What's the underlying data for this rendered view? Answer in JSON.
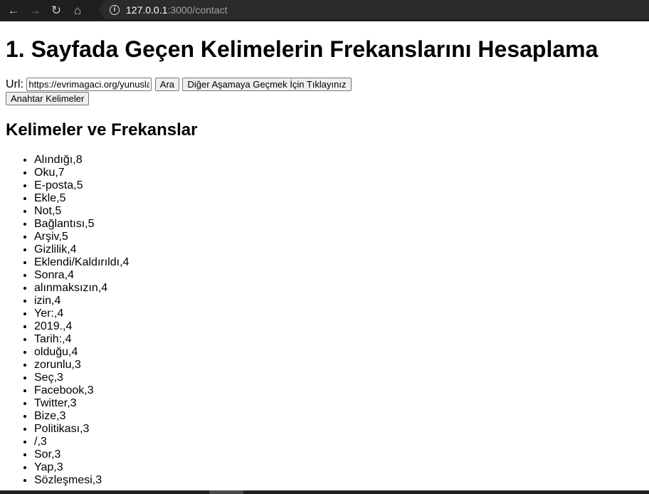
{
  "browser": {
    "url_host": "127.0.0.1",
    "url_path": ":3000/contact",
    "icons": [
      "back-icon",
      "forward-icon",
      "reload-icon",
      "home-icon",
      "info-icon"
    ]
  },
  "page": {
    "title": "1. Sayfada Geçen Kelimelerin Frekanslarını Hesaplama",
    "url_label": "Url:",
    "url_value": "https://evrimagaci.org/yunuslar",
    "search_button": "Ara",
    "next_stage_button": "Diğer Aşamaya Geçmek İçin Tıklayınız",
    "keywords_button": "Anahtar Kelimeler",
    "section_title": "Kelimeler ve Frekanslar",
    "words": [
      "Alındığı,8",
      "Oku,7",
      "E-posta,5",
      "Ekle,5",
      "Not,5",
      "Bağlantısı,5",
      "Arşiv,5",
      "Gizlilik,4",
      "Eklendi/Kaldırıldı,4",
      "Sonra,4",
      "alınmaksızın,4",
      "izin,4",
      "Yer:,4",
      "2019.,4",
      "Tarih:,4",
      "olduğu,4",
      "zorunlu,3",
      "Seç,3",
      "Facebook,3",
      "Twitter,3",
      "Bize,3",
      "Politikası,3",
      "/,3",
      "Sor,3",
      "Yap,3",
      "Sözleşmesi,3"
    ]
  }
}
